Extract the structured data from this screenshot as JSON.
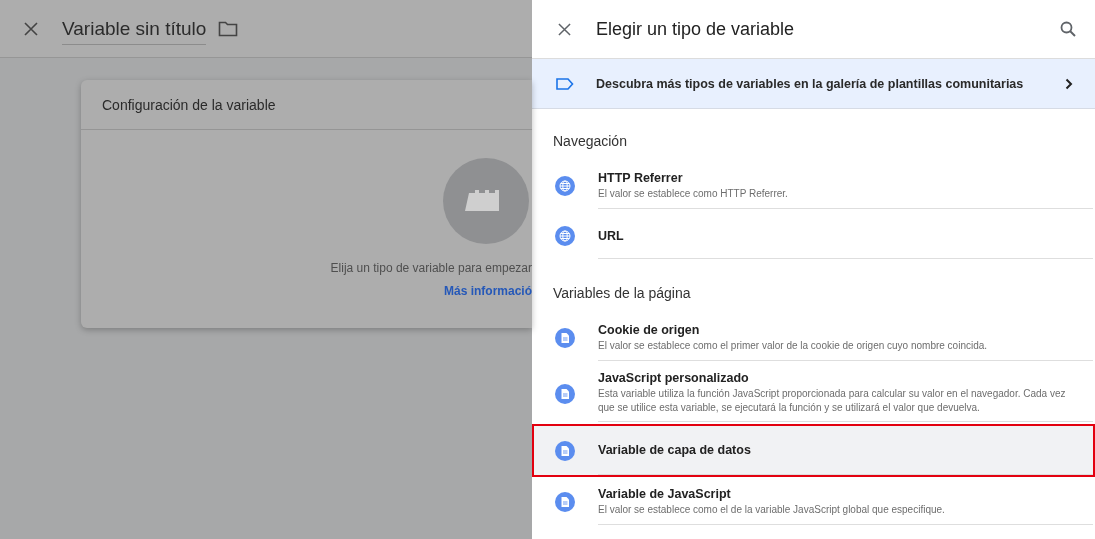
{
  "page": {
    "title": "Variable sin título",
    "card": {
      "title": "Configuración de la variable",
      "empty_text": "Elija un tipo de variable para empezar",
      "link": "Más informació"
    }
  },
  "panel": {
    "title": "Elegir un tipo de variable",
    "banner": "Descubra más tipos de variables en la galería de plantillas comunitarias",
    "sections": [
      {
        "heading": "Navegación",
        "items": [
          {
            "kind": "globe",
            "name": "HTTP Referrer",
            "description": "El valor se establece como HTTP Referrer.",
            "selected": false
          },
          {
            "kind": "globe",
            "name": "URL",
            "selected": false
          }
        ]
      },
      {
        "heading": "Variables de la página",
        "items": [
          {
            "kind": "document",
            "name": "Cookie de origen",
            "description": "El valor se establece como el primer valor de la cookie de origen cuyo nombre coincida.",
            "selected": false
          },
          {
            "kind": "document",
            "name": "JavaScript personalizado",
            "description": "Esta variable utiliza la función JavaScript proporcionada para calcular su valor en el navegador. Cada vez que se utilice esta variable, se ejecutará la función y se utilizará el valor que devuelva.",
            "selected": false
          },
          {
            "kind": "document",
            "name": "Variable de capa de datos",
            "selected": true
          },
          {
            "kind": "document",
            "name": "Variable de JavaScript",
            "description": "El valor se establece como el de la variable JavaScript global que especifique.",
            "selected": false
          }
        ]
      }
    ]
  }
}
